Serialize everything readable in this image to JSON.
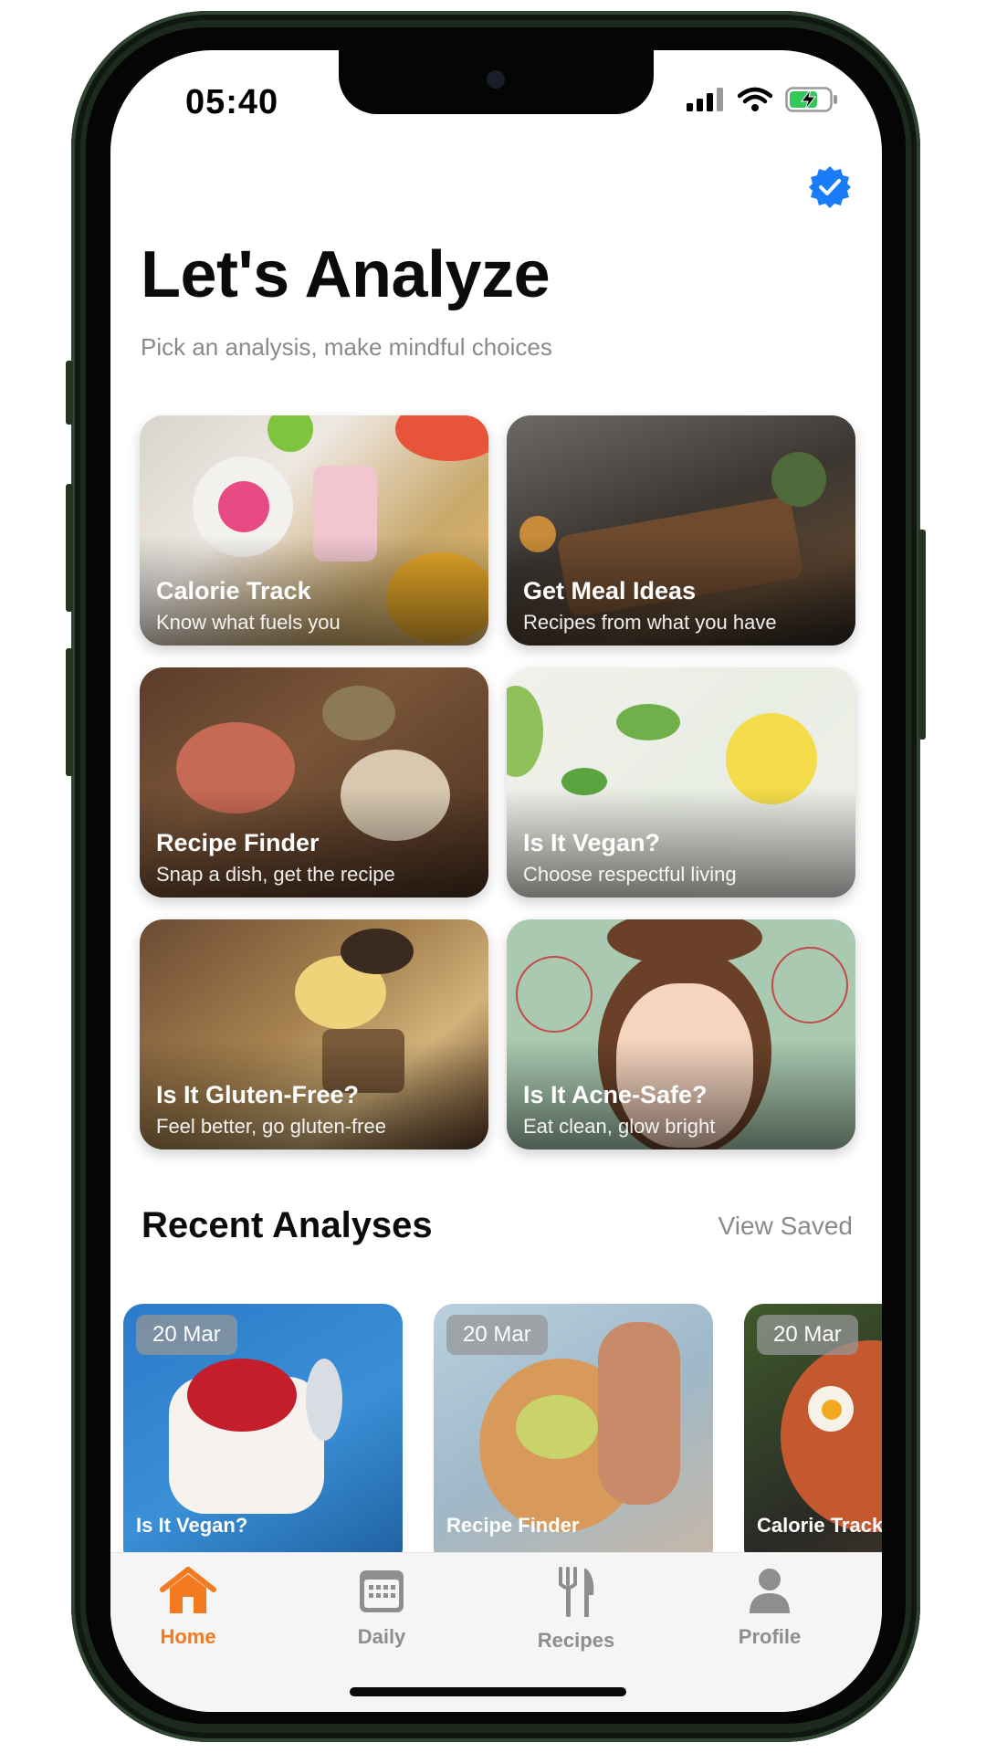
{
  "status_bar": {
    "time": "05:40"
  },
  "header": {
    "title": "Let's Analyze",
    "subtitle": "Pick an analysis, make mindful choices",
    "verified_icon": "verified-badge-icon",
    "accent": "#1a7cf6"
  },
  "analyses": [
    {
      "title": "Calorie Track",
      "subtitle": "Know what fuels you"
    },
    {
      "title": "Get Meal Ideas",
      "subtitle": "Recipes from what you have"
    },
    {
      "title": "Recipe Finder",
      "subtitle": "Snap a dish, get the recipe"
    },
    {
      "title": "Is It Vegan?",
      "subtitle": "Choose respectful living"
    },
    {
      "title": "Is It Gluten-Free?",
      "subtitle": "Feel better, go gluten-free"
    },
    {
      "title": "Is It Acne-Safe?",
      "subtitle": "Eat clean, glow bright"
    }
  ],
  "recent": {
    "title": "Recent Analyses",
    "view_saved": "View Saved",
    "items": [
      {
        "date": "20 Mar",
        "label": "Is It Vegan?"
      },
      {
        "date": "20 Mar",
        "label": "Recipe Finder"
      },
      {
        "date": "20 Mar",
        "label": "Calorie Track"
      }
    ]
  },
  "tabbar": {
    "active_color": "#f47a1f",
    "inactive_color": "#8e8e8e",
    "tabs": [
      {
        "label": "Home",
        "icon": "home-icon",
        "active": true
      },
      {
        "label": "Daily",
        "icon": "calendar-icon",
        "active": false
      },
      {
        "label": "Recipes",
        "icon": "fork-knife-icon",
        "active": false
      },
      {
        "label": "Profile",
        "icon": "person-icon",
        "active": false
      }
    ]
  }
}
